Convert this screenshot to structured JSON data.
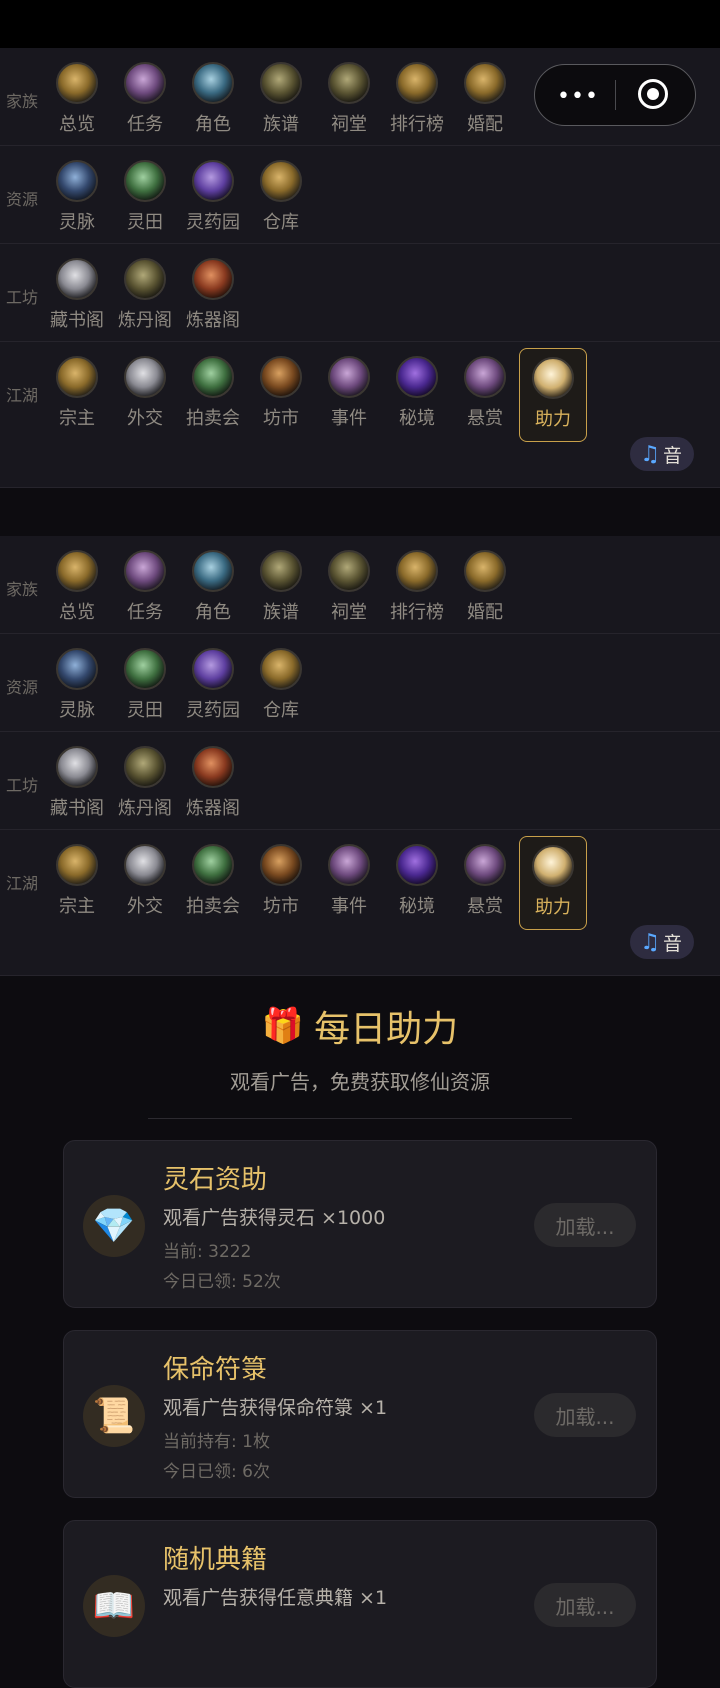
{
  "capsule": {
    "menu_icon": "more-dots-icon",
    "close_icon": "target-icon"
  },
  "nav_rows": [
    {
      "label": "家族",
      "items": [
        {
          "label": "总览",
          "icon": "gold"
        },
        {
          "label": "任务",
          "icon": "purple"
        },
        {
          "label": "角色",
          "icon": "teal"
        },
        {
          "label": "族谱",
          "icon": "olive"
        },
        {
          "label": "祠堂",
          "icon": "olive"
        },
        {
          "label": "排行榜",
          "icon": "gold"
        },
        {
          "label": "婚配",
          "icon": "gold"
        }
      ]
    },
    {
      "label": "资源",
      "items": [
        {
          "label": "灵脉",
          "icon": "blue"
        },
        {
          "label": "灵田",
          "icon": "green"
        },
        {
          "label": "灵药园",
          "icon": "violet"
        },
        {
          "label": "仓库",
          "icon": "gold"
        }
      ]
    },
    {
      "label": "工坊",
      "items": [
        {
          "label": "藏书阁",
          "icon": "silver"
        },
        {
          "label": "炼丹阁",
          "icon": "olive"
        },
        {
          "label": "炼器阁",
          "icon": "red"
        }
      ]
    },
    {
      "label": "江湖",
      "items": [
        {
          "label": "宗主",
          "icon": "gold"
        },
        {
          "label": "外交",
          "icon": "silver"
        },
        {
          "label": "拍卖会",
          "icon": "green"
        },
        {
          "label": "坊市",
          "icon": "bronze"
        },
        {
          "label": "事件",
          "icon": "purple"
        },
        {
          "label": "秘境",
          "icon": "deepviolet"
        },
        {
          "label": "悬赏",
          "icon": "purple"
        },
        {
          "label": "助力",
          "icon": "white",
          "active": true
        }
      ]
    }
  ],
  "music_badge": {
    "note": "♫",
    "label": "音"
  },
  "daily": {
    "title": "每日助力",
    "gift_icon": "🎁",
    "subtitle": "观看广告，免费获取修仙资源",
    "cards": [
      {
        "title": "灵石资助",
        "icon": "💎",
        "desc": "观看广告获得灵石 ×1000",
        "line1": "当前: 3222",
        "line2": "今日已领: 52次",
        "button": "加载..."
      },
      {
        "title": "保命符箓",
        "icon": "📜",
        "desc": "观看广告获得保命符箓 ×1",
        "line1": "当前持有: 1枚",
        "line2": "今日已领: 6次",
        "button": "加载..."
      },
      {
        "title": "随机典籍",
        "icon": "📖",
        "desc": "观看广告获得任意典籍 ×1",
        "line1": "",
        "line2": "",
        "button": "加载..."
      }
    ]
  }
}
